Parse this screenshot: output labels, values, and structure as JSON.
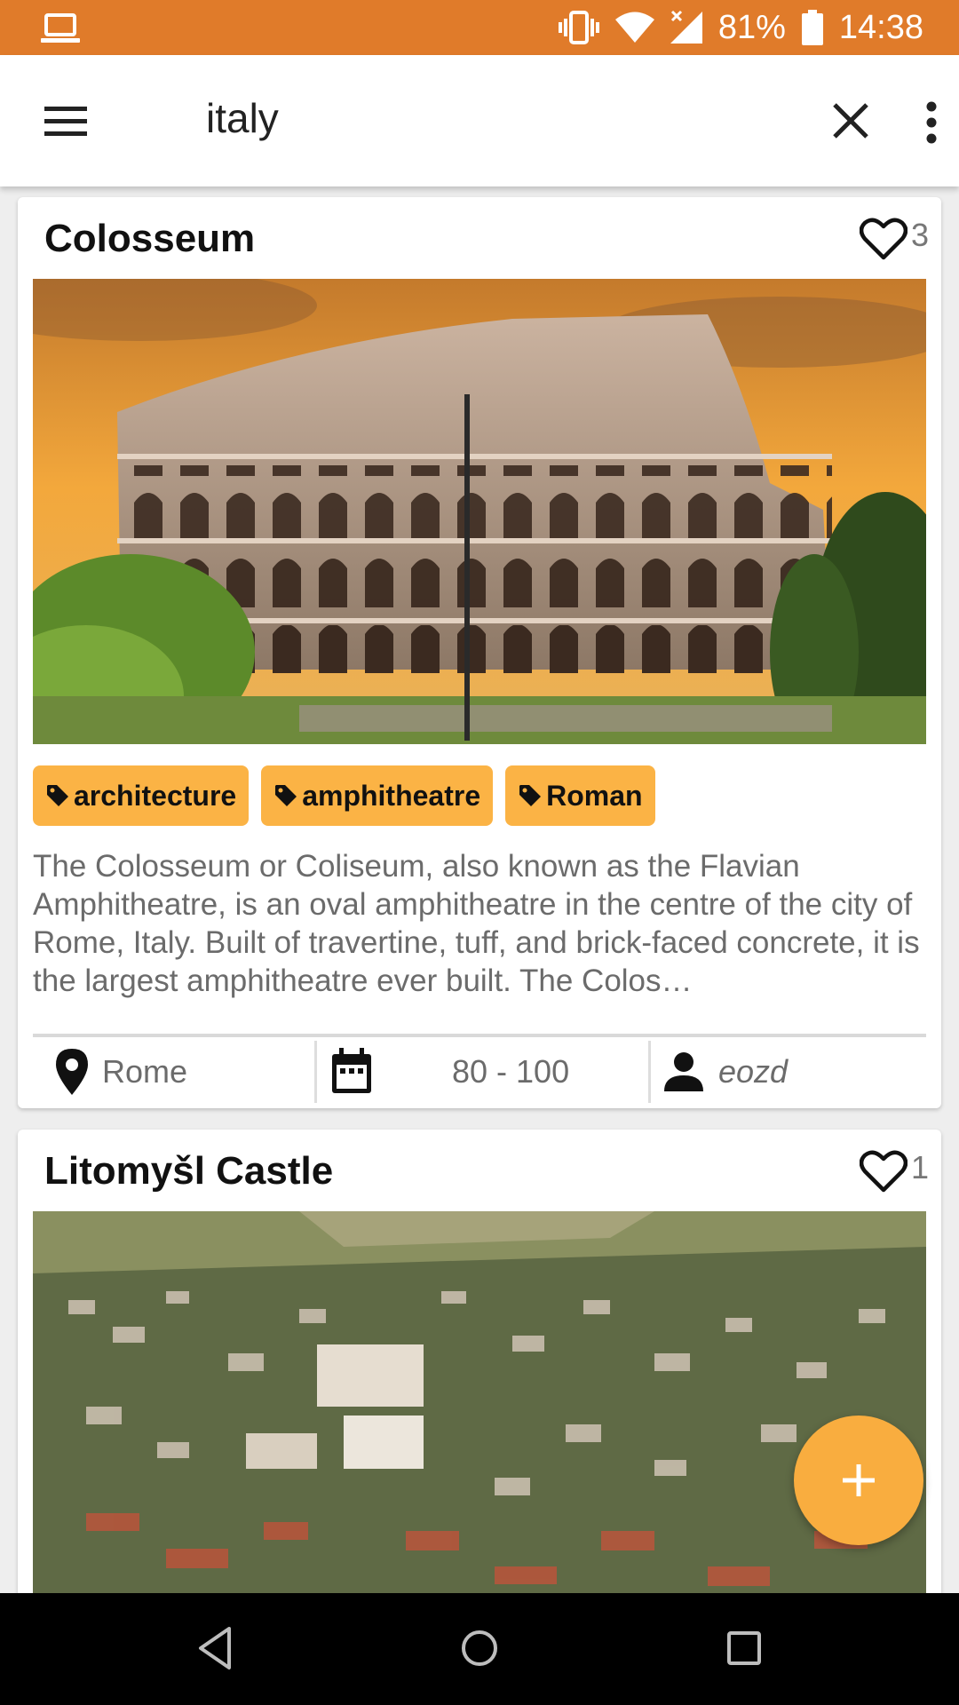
{
  "status_bar": {
    "battery": "81%",
    "time": "14:38"
  },
  "search": {
    "query": "italy"
  },
  "cards": [
    {
      "title": "Colosseum",
      "likes": "3",
      "tags": [
        "architecture",
        "amphitheatre",
        "Roman"
      ],
      "description": "The Colosseum or Coliseum, also known as the Flavian Amphitheatre, is an oval amphitheatre in the centre of the city of Rome, Italy. Built of travertine, tuff, and brick-faced concrete, it is the largest amphitheatre ever built. The Colos…",
      "location": "Rome",
      "years": "80 - 100",
      "user": "eozd"
    },
    {
      "title": "Litomyšl Castle",
      "likes": "1"
    }
  ],
  "colors": {
    "status_bar": "#e07b2a",
    "tag": "#fbb345",
    "fab": "#f9ad3f"
  },
  "icons": [
    "laptop-icon",
    "vibrate-icon",
    "wifi-icon",
    "signal-icon",
    "battery-icon",
    "menu-icon",
    "close-icon",
    "more-vert-icon",
    "heart-icon",
    "tag-icon",
    "location-pin-icon",
    "calendar-icon",
    "person-icon",
    "plus-icon",
    "back-icon",
    "home-icon",
    "recents-icon"
  ]
}
